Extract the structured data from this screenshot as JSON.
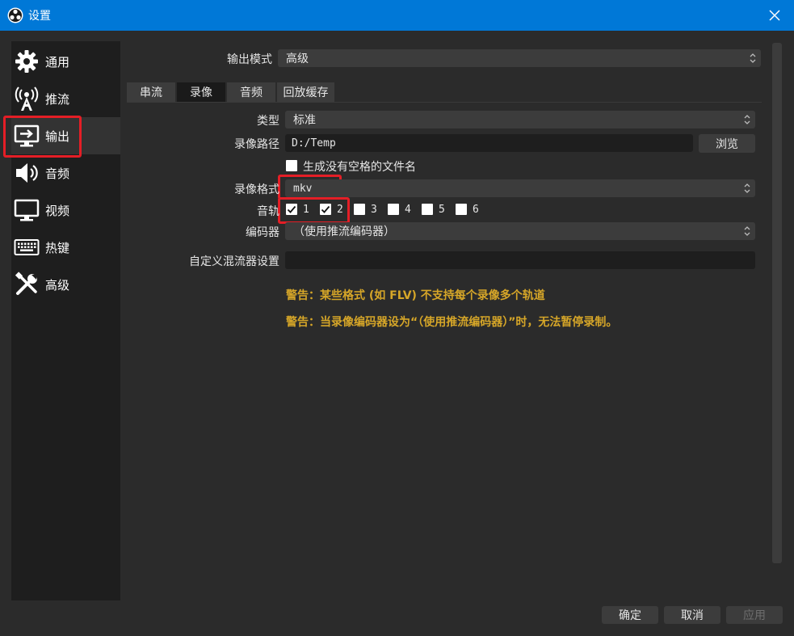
{
  "window": {
    "title": "设置"
  },
  "sidebar": {
    "items": [
      {
        "label": "通用",
        "icon": "gear-icon"
      },
      {
        "label": "推流",
        "icon": "broadcast-tower-icon"
      },
      {
        "label": "输出",
        "icon": "output-monitor-icon"
      },
      {
        "label": "音频",
        "icon": "speaker-icon"
      },
      {
        "label": "视频",
        "icon": "monitor-icon"
      },
      {
        "label": "热键",
        "icon": "keyboard-icon"
      },
      {
        "label": "高级",
        "icon": "tools-icon"
      }
    ],
    "active_index": 2
  },
  "output_mode": {
    "label": "输出模式",
    "value": "高级"
  },
  "tabs": [
    {
      "label": "串流"
    },
    {
      "label": "录像"
    },
    {
      "label": "音频"
    },
    {
      "label": "回放缓存"
    }
  ],
  "active_tab": 1,
  "recording": {
    "type": {
      "label": "类型",
      "value": "标准"
    },
    "path": {
      "label": "录像路径",
      "value": "D:/Temp",
      "browse": "浏览"
    },
    "no_space": {
      "label": "生成没有空格的文件名",
      "checked": false
    },
    "format": {
      "label": "录像格式",
      "value": "mkv"
    },
    "tracks": {
      "label": "音轨",
      "items": [
        {
          "label": "1",
          "checked": true
        },
        {
          "label": "2",
          "checked": true
        },
        {
          "label": "3",
          "checked": false
        },
        {
          "label": "4",
          "checked": false
        },
        {
          "label": "5",
          "checked": false
        },
        {
          "label": "6",
          "checked": false
        }
      ]
    },
    "encoder": {
      "label": "编码器",
      "value": "（使用推流编码器）"
    },
    "muxer": {
      "label": "自定义混流器设置",
      "value": ""
    }
  },
  "warnings": [
    "警告：某些格式 (如 FLV) 不支持每个录像多个轨道",
    "警告：当录像编码器设为“（使用推流编码器）”时，无法暂停录制。"
  ],
  "buttons": {
    "ok": "确定",
    "cancel": "取消",
    "apply": "应用"
  },
  "colors": {
    "titlebar": "#0078d7",
    "highlight": "#e41e26",
    "warning": "#d6a628"
  }
}
